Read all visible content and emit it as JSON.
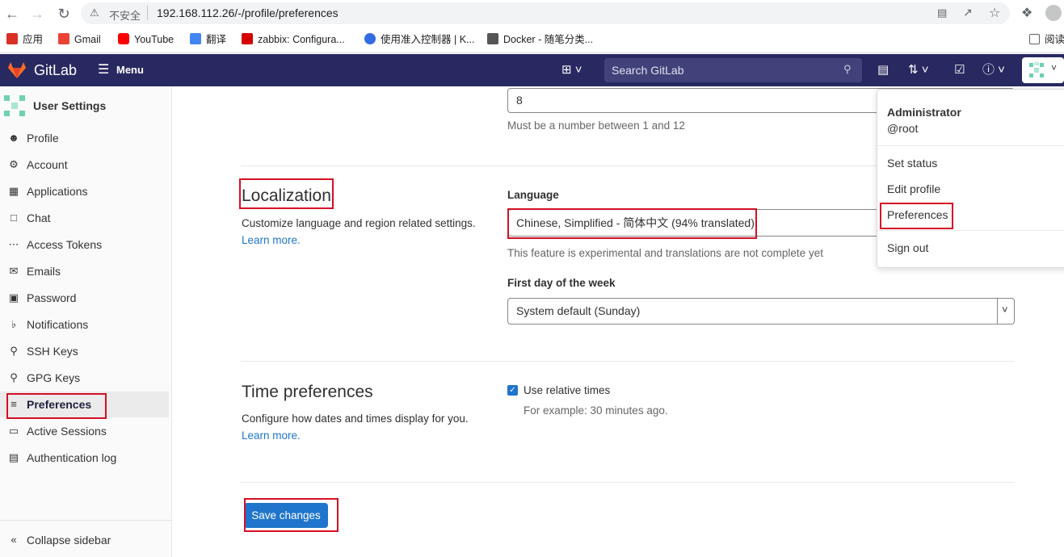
{
  "browser": {
    "insecure_label": "不安全",
    "url": "192.168.112.26/-/profile/preferences",
    "bookmarks": [
      {
        "label": "应用",
        "color": "#d93025"
      },
      {
        "label": "Gmail",
        "color": "#ea4335"
      },
      {
        "label": "YouTube",
        "color": "#ff0000"
      },
      {
        "label": "翻译",
        "color": "#4285f4"
      },
      {
        "label": "zabbix: Configura...",
        "color": "#d40000"
      },
      {
        "label": "使用准入控制器 | K...",
        "color": "#326ce5"
      },
      {
        "label": "Docker - 随笔分类...",
        "color": "#555555"
      }
    ],
    "reading_label": "阅读"
  },
  "header": {
    "brand": "GitLab",
    "menu_label": "Menu",
    "search_placeholder": "Search GitLab",
    "brand_color": "#292961"
  },
  "sidebar": {
    "title": "User Settings",
    "items": [
      {
        "label": "Profile",
        "icon": "profile-icon"
      },
      {
        "label": "Account",
        "icon": "account-icon"
      },
      {
        "label": "Applications",
        "icon": "applications-icon"
      },
      {
        "label": "Chat",
        "icon": "chat-icon"
      },
      {
        "label": "Access Tokens",
        "icon": "token-icon"
      },
      {
        "label": "Emails",
        "icon": "email-icon"
      },
      {
        "label": "Password",
        "icon": "lock-icon"
      },
      {
        "label": "Notifications",
        "icon": "bell-icon"
      },
      {
        "label": "SSH Keys",
        "icon": "key-icon"
      },
      {
        "label": "GPG Keys",
        "icon": "key-icon"
      },
      {
        "label": "Preferences",
        "icon": "preferences-icon",
        "active": true
      },
      {
        "label": "Active Sessions",
        "icon": "monitor-icon"
      },
      {
        "label": "Authentication log",
        "icon": "log-icon"
      }
    ],
    "collapse_label": "Collapse sidebar"
  },
  "main": {
    "top_field_value": "8",
    "top_field_hint": "Must be a number between 1 and 12",
    "localization": {
      "title": "Localization",
      "description": "Customize language and region related settings.",
      "learn_more": "Learn more.",
      "language_label": "Language",
      "language_value": "Chinese, Simplified - 简体中文 (94% translated)",
      "language_hint": "This feature is experimental and translations are not complete yet",
      "first_day_label": "First day of the week",
      "first_day_value": "System default (Sunday)"
    },
    "time": {
      "title": "Time preferences",
      "description": "Configure how dates and times display for you.",
      "learn_more": "Learn more.",
      "relative_label": "Use relative times",
      "relative_checked": true,
      "example": "For example: 30 minutes ago."
    },
    "save_label": "Save changes"
  },
  "dropdown": {
    "name": "Administrator",
    "username": "@root",
    "set_status": "Set status",
    "edit_profile": "Edit profile",
    "preferences": "Preferences",
    "sign_out": "Sign out"
  },
  "colors": {
    "accent": "#1f75cb",
    "highlight_box": "#d50f25"
  }
}
